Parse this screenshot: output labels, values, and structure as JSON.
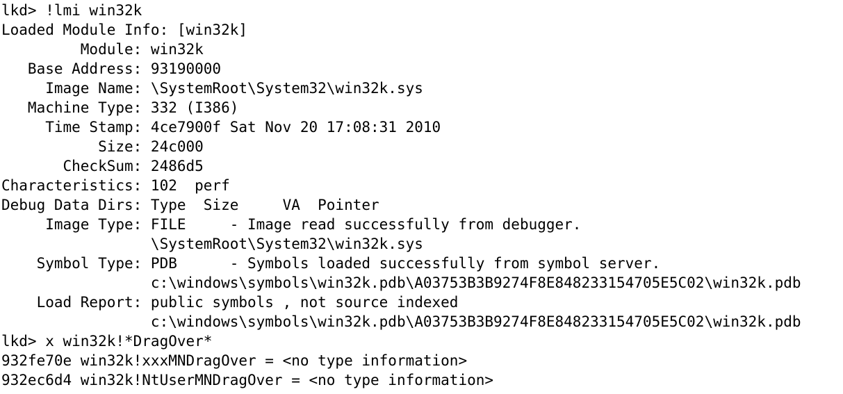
{
  "console": {
    "lines": [
      "lkd> !lmi win32k",
      "Loaded Module Info: [win32k]",
      "         Module: win32k",
      "   Base Address: 93190000",
      "     Image Name: \\SystemRoot\\System32\\win32k.sys",
      "   Machine Type: 332 (I386)",
      "     Time Stamp: 4ce7900f Sat Nov 20 17:08:31 2010",
      "           Size: 24c000",
      "       CheckSum: 2486d5",
      "Characteristics: 102  perf",
      "Debug Data Dirs: Type  Size     VA  Pointer",
      "     Image Type: FILE     - Image read successfully from debugger.",
      "                 \\SystemRoot\\System32\\win32k.sys",
      "    Symbol Type: PDB      - Symbols loaded successfully from symbol server.",
      "                 c:\\windows\\symbols\\win32k.pdb\\A03753B3B9274F8E848233154705E5C02\\win32k.pdb",
      "    Load Report: public symbols , not source indexed",
      "                 c:\\windows\\symbols\\win32k.pdb\\A03753B3B9274F8E848233154705E5C02\\win32k.pdb",
      "lkd> x win32k!*DragOver*",
      "932fe70e win32k!xxxMNDragOver = <no type information>",
      "932ec6d4 win32k!NtUserMNDragOver = <no type information>"
    ]
  }
}
